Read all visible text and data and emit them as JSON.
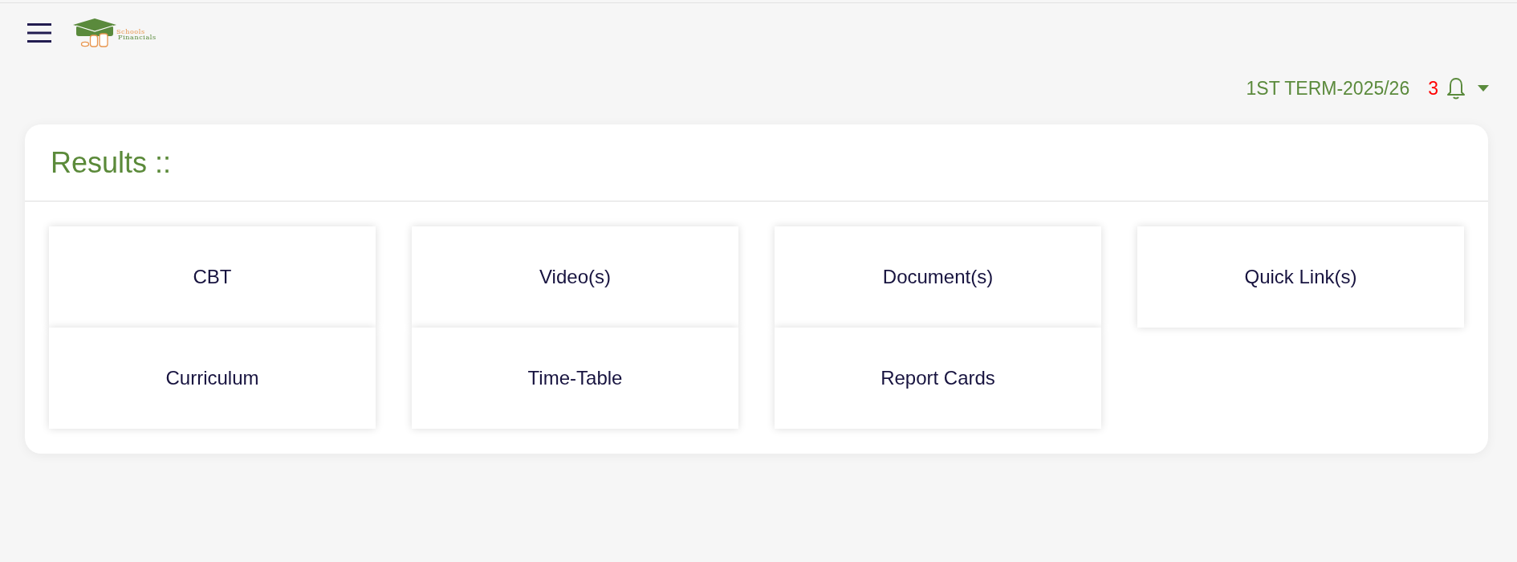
{
  "logo": {
    "lines": [
      "Schools",
      "Financials"
    ]
  },
  "term": "1ST TERM-2025/26",
  "notifications": {
    "count": "3"
  },
  "card": {
    "title": "Results ::",
    "tiles": [
      {
        "label": "CBT"
      },
      {
        "label": "Video(s)"
      },
      {
        "label": "Document(s)"
      },
      {
        "label": "Quick Link(s)"
      },
      {
        "label": "Curriculum"
      },
      {
        "label": "Time-Table"
      },
      {
        "label": "Report Cards"
      }
    ]
  }
}
